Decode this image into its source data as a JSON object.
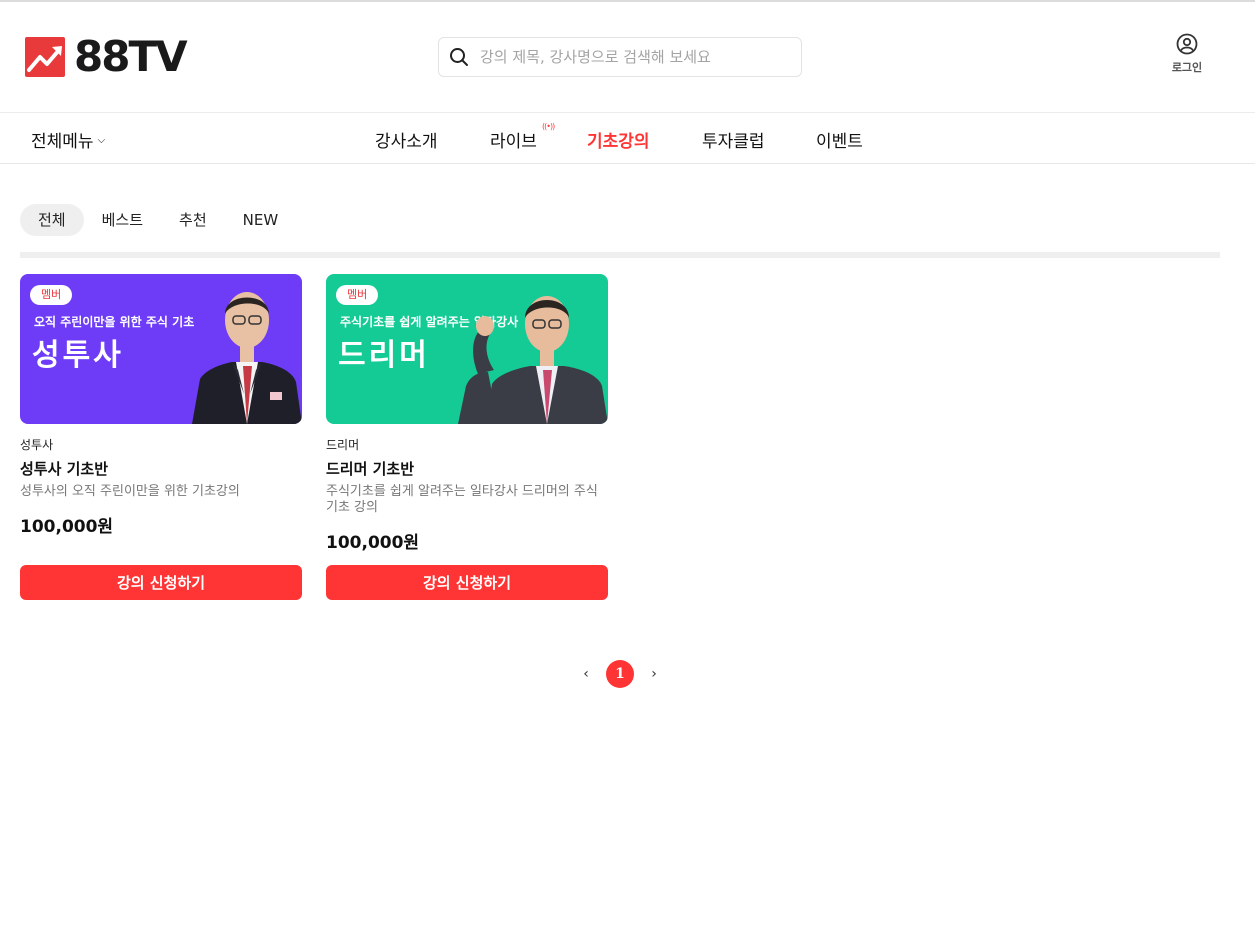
{
  "brand": {
    "name": "88TV",
    "accent": "#ff3535"
  },
  "search": {
    "placeholder": "강의 제목, 강사명으로 검색해 보세요"
  },
  "login": {
    "label": "로그인"
  },
  "nav": {
    "all_menu": "전체메뉴",
    "items": [
      "강사소개",
      "라이브",
      "기초강의",
      "투자클럽",
      "이벤트"
    ],
    "active": "기초강의",
    "live_badge": "((•))"
  },
  "filter_tabs": {
    "items": [
      "전체",
      "베스트",
      "추천",
      "NEW"
    ],
    "active": "전체"
  },
  "courses": [
    {
      "badge": "멤버",
      "banner_subtitle": "오직 주린이만을 위한 주식 기초",
      "banner_title": "성투사",
      "banner_color": "#6e3cf7",
      "instructor": "성투사",
      "title": "성투사 기초반",
      "description": "성투사의 오직 주린이만을 위한 기초강의",
      "price": "100,000원",
      "button": "강의 신청하기"
    },
    {
      "badge": "멤버",
      "banner_subtitle": "주식기초를 쉽게 알려주는 일타강사",
      "banner_title": "드리머",
      "banner_color": "#14cb95",
      "instructor": "드리머",
      "title": "드리머 기초반",
      "description": "주식기초를 쉽게 알려주는 일타강사 드리머의 주식 기초 강의",
      "price": "100,000원",
      "button": "강의 신청하기"
    }
  ],
  "pagination": {
    "prev": "‹",
    "current": "1",
    "next": "›"
  }
}
